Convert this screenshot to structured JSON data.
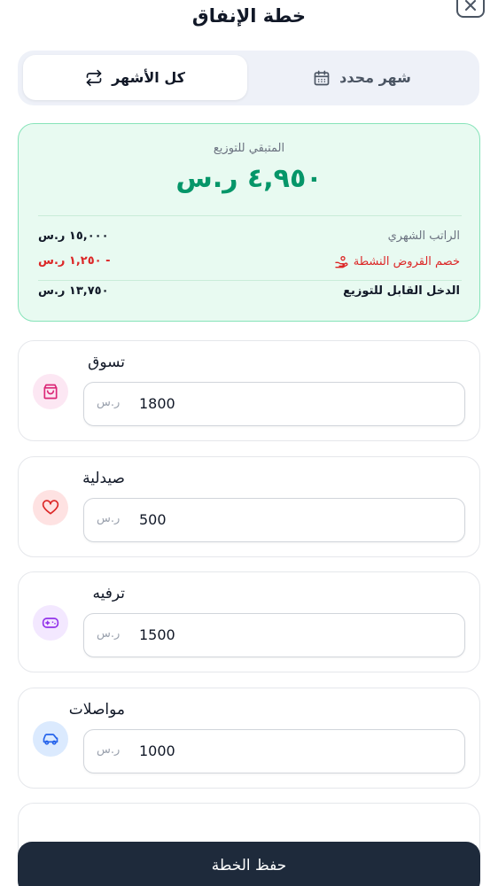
{
  "header": {
    "title": "خطة الإنفاق"
  },
  "tabs": [
    {
      "label": "كل الأشهر",
      "icon": "repeat-icon",
      "active": true
    },
    {
      "label": "شهر محدد",
      "icon": "calendar-icon",
      "active": false
    }
  ],
  "summary": {
    "remaining_label": "المتبقي للتوزيع",
    "remaining_amount": "٤,٩٥٠ ر.س",
    "rows": [
      {
        "label": "الراتب الشهري",
        "value": "١٥,٠٠٠ ر.س"
      },
      {
        "label": "خصم القروض النشطة",
        "value": "- ١,٢٥٠ ر.س"
      },
      {
        "label": "الدخل القابل للتوزيع",
        "value": "١٣,٧٥٠ ر.س"
      }
    ]
  },
  "categories": [
    {
      "name": "تسوق",
      "value": "1800",
      "unit": "ر.س",
      "icon": "shopping-bag-icon",
      "color": "#db2777",
      "bg": "#fce7f3"
    },
    {
      "name": "صيدلية",
      "value": "500",
      "unit": "ر.س",
      "icon": "heart-icon",
      "color": "#dc2626",
      "bg": "#fee2e2"
    },
    {
      "name": "ترفيه",
      "value": "1500",
      "unit": "ر.س",
      "icon": "gamepad-icon",
      "color": "#9333ea",
      "bg": "#f3e8ff"
    },
    {
      "name": "مواصلات",
      "value": "1000",
      "unit": "ر.س",
      "icon": "car-icon",
      "color": "#2563eb",
      "bg": "#dbeafe"
    }
  ],
  "save_label": "حفظ الخطة"
}
